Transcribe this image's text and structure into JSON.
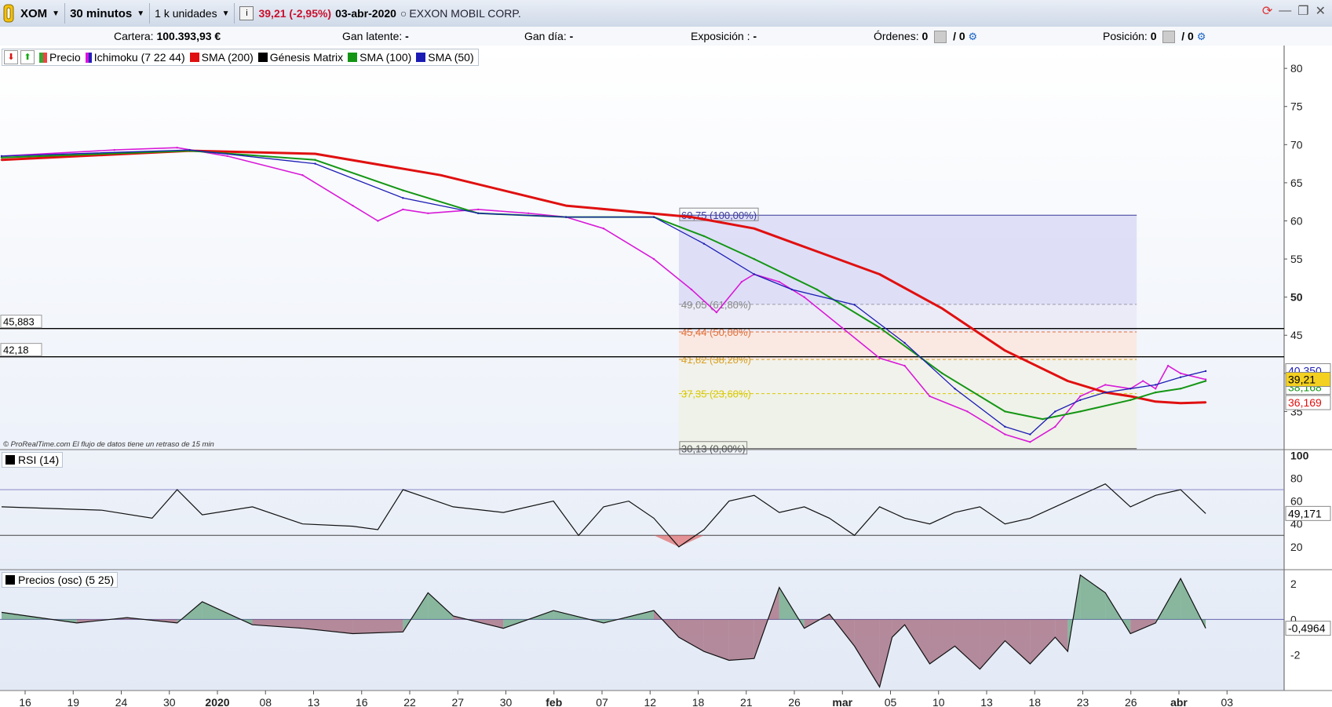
{
  "toolbar": {
    "ticker": "XOM",
    "timeframe": "30 minutos",
    "units": "1 k unidades",
    "info": "i",
    "price_change": "39,21 (-2,95%)",
    "date": "03-abr-2020",
    "company": "EXXON MOBIL CORP."
  },
  "account": {
    "cartera_label": "Cartera:",
    "cartera_value": "100.393,93 €",
    "latente_label": "Gan latente:",
    "latente_value": "-",
    "dia_label": "Gan día:",
    "dia_value": "-",
    "expo_label": "Exposición :",
    "expo_value": "-",
    "ordenes_label": "Órdenes:",
    "ordenes_a": "0",
    "ordenes_b": "/ 0",
    "posicion_label": "Posición:",
    "posicion_a": "0",
    "posicion_b": "/ 0"
  },
  "legend": {
    "precio": "Precio",
    "ichimoku": "Ichimoku (7 22 44)",
    "sma200": "SMA (200)",
    "genesis": "Génesis Matrix",
    "sma100": "SMA (100)",
    "sma50": "SMA (50)"
  },
  "colors": {
    "sma200": "#e01010",
    "sma100": "#149614",
    "sma50": "#1c1cb4",
    "price": "#d81bd8",
    "rsi_fill": "#e06a6a",
    "osc_pos": "#3a8a55",
    "osc_neg": "#8a3a50"
  },
  "watermark": "© ProRealTime.com  El flujo de datos tiene un retraso de 15 min",
  "chart_data": [
    {
      "type": "line",
      "title": "XOM",
      "x_ticks": [
        "16",
        "19",
        "24",
        "30",
        "2020",
        "08",
        "13",
        "16",
        "22",
        "27",
        "30",
        "feb",
        "07",
        "12",
        "18",
        "21",
        "26",
        "mar",
        "05",
        "10",
        "13",
        "18",
        "23",
        "26",
        "abr",
        "03"
      ],
      "ylim": [
        30,
        83
      ],
      "y_ticks": [
        35,
        40,
        45,
        50,
        55,
        60,
        65,
        70,
        75,
        80
      ],
      "series": [
        {
          "name": "Precio",
          "x": [
            0,
            9,
            14,
            18,
            24,
            28,
            30,
            32,
            34,
            38,
            42,
            45,
            48,
            52,
            55,
            57,
            59,
            60,
            62,
            64,
            67,
            70,
            72,
            74,
            77,
            79,
            80,
            82,
            84,
            86,
            88,
            90,
            91,
            92,
            93,
            94,
            96
          ],
          "y": [
            68.5,
            69.3,
            69.6,
            68.5,
            66,
            62,
            60,
            61.5,
            61,
            61.5,
            61,
            60.5,
            59,
            55,
            51,
            48,
            52,
            53,
            52,
            50,
            46,
            42,
            41,
            37,
            35,
            33,
            32,
            31,
            33,
            37,
            38.5,
            38,
            39,
            38,
            41,
            40,
            39.2
          ]
        },
        {
          "name": "SMA (200)",
          "x": [
            0,
            15,
            25,
            35,
            45,
            55,
            60,
            65,
            70,
            75,
            80,
            85,
            88,
            90,
            92,
            94,
            96
          ],
          "y": [
            68,
            69.2,
            68.8,
            66,
            62,
            60.5,
            59,
            56,
            53,
            48.5,
            43,
            39,
            37.5,
            37,
            36.3,
            36.1,
            36.2
          ]
        },
        {
          "name": "SMA (100)",
          "x": [
            0,
            15,
            25,
            32,
            38,
            45,
            52,
            56,
            60,
            65,
            70,
            75,
            80,
            83,
            86,
            90,
            92,
            94,
            96
          ],
          "y": [
            68.3,
            69.2,
            68,
            64,
            61,
            60.5,
            60.5,
            58,
            55,
            51,
            46,
            40,
            35,
            34,
            35,
            36.5,
            37.5,
            38,
            39
          ]
        },
        {
          "name": "SMA (50)",
          "x": [
            0,
            15,
            25,
            32,
            38,
            45,
            52,
            56,
            60,
            63,
            68,
            72,
            76,
            80,
            82,
            84,
            86,
            88,
            90,
            92,
            94,
            96
          ],
          "y": [
            68.5,
            69.3,
            67.5,
            63,
            61,
            60.5,
            60.5,
            57,
            53,
            51,
            49,
            44,
            38,
            33,
            32,
            35,
            36.5,
            37.5,
            38,
            38.5,
            39.5,
            40.3
          ]
        }
      ],
      "price_labels": {
        "last": "39,21",
        "ichimoku_a": "40,350",
        "ichimoku_b": "38,168",
        "sma200": "36,169"
      },
      "horizontal_lines": [
        {
          "label": "45,883",
          "y": 45.883
        },
        {
          "label": "42,18",
          "y": 42.18
        }
      ],
      "fibonacci": [
        {
          "label": "60,75 (100,00%)",
          "y": 60.75,
          "color": "#3a3a9a",
          "fill": "#dcdcf6"
        },
        {
          "label": "49,05 (61,80%)",
          "y": 49.05,
          "color": "#9a9aaa",
          "fill": "#eaeaf6"
        },
        {
          "label": "45,44 (50,00%)",
          "y": 45.44,
          "color": "#e0703a",
          "fill": "#fbe8e0"
        },
        {
          "label": "41,82 (38,20%)",
          "y": 41.82,
          "color": "#d8a020",
          "fill": "#f2f2ea"
        },
        {
          "label": "37,35 (23,60%)",
          "y": 37.35,
          "color": "#d8c800",
          "fill": "#eef2e6"
        },
        {
          "label": "30,13 (0,00%)",
          "y": 30.13,
          "color": "#555555",
          "fill": "#eef2e6"
        }
      ]
    },
    {
      "type": "line",
      "title": "RSI (14)",
      "ylim": [
        0,
        105
      ],
      "y_ticks": [
        20,
        40,
        60,
        80,
        100
      ],
      "levels": [
        70,
        30
      ],
      "last_label": "49,171",
      "series": [
        {
          "name": "RSI (14)",
          "x": [
            0,
            8,
            12,
            14,
            16,
            20,
            24,
            28,
            30,
            32,
            36,
            40,
            44,
            46,
            48,
            50,
            52,
            54,
            56,
            58,
            60,
            62,
            64,
            66,
            68,
            70,
            72,
            74,
            76,
            78,
            80,
            82,
            84,
            86,
            88,
            90,
            92,
            94,
            96
          ],
          "y": [
            55,
            52,
            45,
            70,
            48,
            55,
            40,
            38,
            35,
            70,
            55,
            50,
            60,
            30,
            55,
            60,
            45,
            20,
            35,
            60,
            65,
            50,
            55,
            45,
            30,
            55,
            45,
            40,
            50,
            55,
            40,
            45,
            55,
            65,
            75,
            55,
            65,
            70,
            49.171
          ]
        }
      ]
    },
    {
      "type": "area",
      "title": "Precios (osc) (5 25)",
      "ylim": [
        -4,
        2.8
      ],
      "y_ticks": [
        -2,
        0,
        2
      ],
      "last_label": "-0,4964",
      "series": [
        {
          "name": "Precios (osc) (5 25)",
          "x": [
            0,
            6,
            10,
            14,
            16,
            20,
            24,
            28,
            32,
            34,
            36,
            40,
            44,
            48,
            52,
            54,
            56,
            58,
            60,
            62,
            64,
            66,
            68,
            70,
            71,
            72,
            74,
            76,
            78,
            80,
            82,
            84,
            85,
            86,
            88,
            90,
            92,
            94,
            96
          ],
          "y": [
            0.4,
            -0.2,
            0.1,
            -0.2,
            1.0,
            -0.3,
            -0.5,
            -0.8,
            -0.7,
            1.5,
            0.2,
            -0.5,
            0.5,
            -0.2,
            0.5,
            -1.0,
            -1.8,
            -2.3,
            -2.2,
            1.8,
            -0.5,
            0.3,
            -1.5,
            -3.8,
            -1.0,
            -0.3,
            -2.5,
            -1.5,
            -2.8,
            -1.2,
            -2.5,
            -1.0,
            -1.8,
            2.5,
            1.5,
            -0.8,
            -0.2,
            2.3,
            -0.4964
          ]
        }
      ]
    }
  ]
}
